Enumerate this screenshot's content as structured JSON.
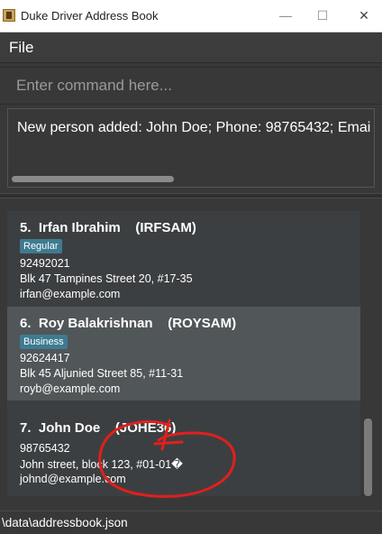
{
  "window": {
    "title": "Duke Driver Address Book",
    "minimize": "—",
    "maximize": "☐",
    "close": "✕"
  },
  "menu": {
    "file": "File"
  },
  "command": {
    "placeholder": "Enter command here..."
  },
  "result": {
    "text": "New person added: John Doe; Phone: 98765432; Emai"
  },
  "persons": [
    {
      "index": "5.",
      "name": "Irfan Ibrahim",
      "code": "(IRFSAM)",
      "tag": "Regular",
      "phone": "92492021",
      "address": "Blk 47 Tampines Street 20, #17-35",
      "email": "irfan@example.com"
    },
    {
      "index": "6.",
      "name": "Roy Balakrishnan",
      "code": "(ROYSAM)",
      "tag": "Business",
      "phone": "92624417",
      "address": "Blk 45 Aljunied Street 85, #11-31",
      "email": "royb@example.com"
    },
    {
      "index": "7.",
      "name": "John Doe",
      "code": "(JOHE36)",
      "tag": "",
      "phone": "98765432",
      "address": "John street, block 123, #01-01�",
      "email": "johnd@example.com"
    }
  ],
  "status": {
    "path": "\\data\\addressbook.json"
  },
  "colors": {
    "background": "#383838",
    "tag": "#3e7b91",
    "annotation": "#e0201c"
  }
}
